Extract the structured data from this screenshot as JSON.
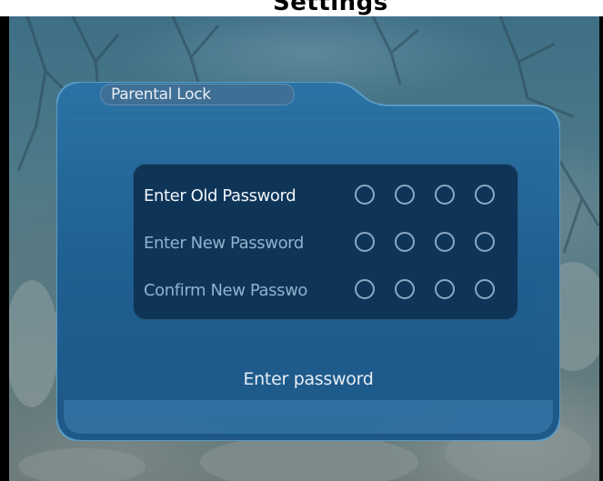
{
  "window": {
    "top_title": "Settings"
  },
  "dialog": {
    "title": "Parental Lock",
    "rows": [
      {
        "label": "Enter Old Password",
        "state": "active",
        "digits_entered": 0,
        "digits_total": 4
      },
      {
        "label": "Enter New Password",
        "state": "inactive",
        "digits_entered": 0,
        "digits_total": 4
      },
      {
        "label": "Confirm New Passwo",
        "state": "inactive",
        "digits_entered": 0,
        "digits_total": 4
      }
    ],
    "status": "Enter password"
  },
  "colors": {
    "dialog_bg": "#1a5a8e",
    "panel_bg": "#0e3558",
    "title_tab": "#3f6f95",
    "active_text": "#f2f6fa",
    "inactive_text": "#8fb3cf",
    "dot_outline": "#8aa9c4"
  },
  "icons": {
    "digit_slot": "empty-circle-icon"
  }
}
